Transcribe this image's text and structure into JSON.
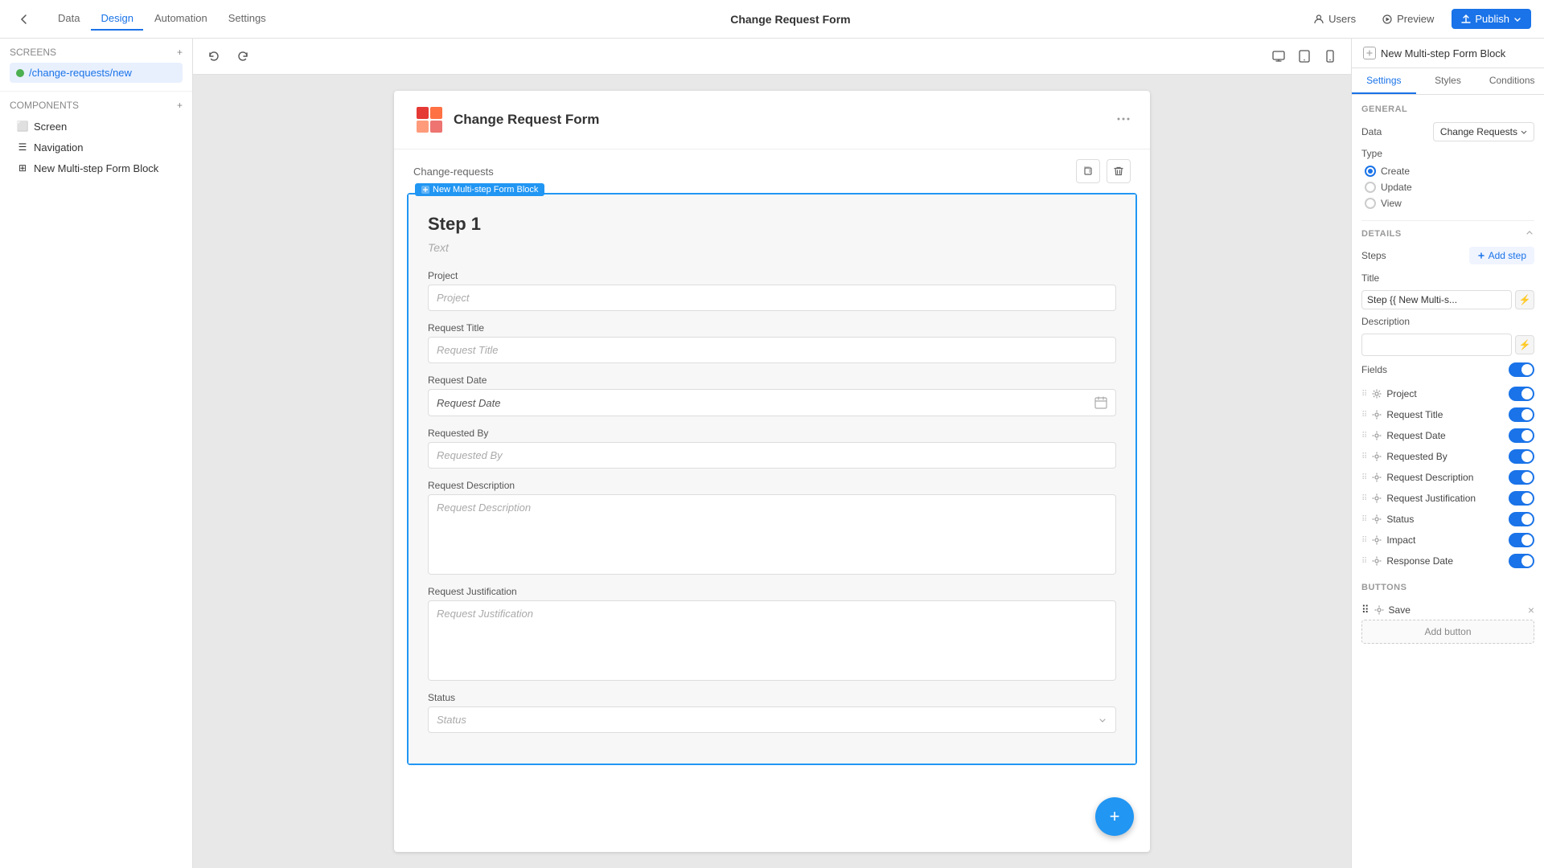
{
  "topNav": {
    "back_icon": "←",
    "tabs": [
      "Data",
      "Design",
      "Automation",
      "Settings"
    ],
    "active_tab": "Design",
    "page_title": "Change Request Form",
    "right_btns": {
      "users": "Users",
      "preview": "Preview",
      "publish": "Publish"
    }
  },
  "leftPanel": {
    "screens_label": "Screens",
    "screens": [
      {
        "name": "/change-requests/new",
        "active": true
      }
    ],
    "components_label": "Components",
    "components": [
      {
        "name": "Screen",
        "icon": "⬜"
      },
      {
        "name": "Navigation",
        "icon": "☰"
      },
      {
        "name": "New Multi-step Form Block",
        "icon": "⊞"
      }
    ]
  },
  "canvasToolbar": {
    "undo": "↩",
    "redo": "↪",
    "desktop_icon": "🖥",
    "tablet_icon": "📱",
    "mobile_icon": "📱"
  },
  "form": {
    "title": "Change Request Form",
    "breadcrumb": "Change-requests",
    "block_label": "New Multi-step Form Block",
    "step_title": "Step 1",
    "step_text": "Text",
    "fields": [
      {
        "label": "Project",
        "placeholder": "Project",
        "type": "input"
      },
      {
        "label": "Request Title",
        "placeholder": "Request Title",
        "type": "input"
      },
      {
        "label": "Request Date",
        "placeholder": "Request Date",
        "type": "date"
      },
      {
        "label": "Requested By",
        "placeholder": "Requested By",
        "type": "input"
      },
      {
        "label": "Request Description",
        "placeholder": "Request Description",
        "type": "textarea"
      },
      {
        "label": "Request Justification",
        "placeholder": "Request Justification",
        "type": "textarea"
      },
      {
        "label": "Status",
        "placeholder": "Status",
        "type": "select"
      }
    ],
    "fab_icon": "+"
  },
  "rightPanel": {
    "panel_title": "New Multi-step Form Block",
    "tabs": [
      "Settings",
      "Styles",
      "Conditions"
    ],
    "active_tab": "Settings",
    "general": {
      "label": "GENERAL",
      "data_label": "Data",
      "data_value": "Change Requests",
      "type_label": "Type",
      "type_options": [
        "Create",
        "Update",
        "View"
      ],
      "type_selected": "Create"
    },
    "details": {
      "label": "DETAILS",
      "steps_label": "Steps",
      "add_step": "Add step",
      "title_label": "Title",
      "title_value": "Step {{ New Multi-s...",
      "description_label": "Description",
      "fields_label": "Fields",
      "fields": [
        {
          "name": "Project",
          "enabled": true
        },
        {
          "name": "Request Title",
          "enabled": true
        },
        {
          "name": "Request Date",
          "enabled": true
        },
        {
          "name": "Requested By",
          "enabled": true
        },
        {
          "name": "Request Description",
          "enabled": true
        },
        {
          "name": "Request Justification",
          "enabled": true
        },
        {
          "name": "Status",
          "enabled": true
        },
        {
          "name": "Impact",
          "enabled": true
        },
        {
          "name": "Response Date",
          "enabled": true
        }
      ]
    },
    "buttons": {
      "label": "Buttons",
      "items": [
        {
          "name": "Save"
        }
      ],
      "add_btn_label": "Add button"
    }
  }
}
